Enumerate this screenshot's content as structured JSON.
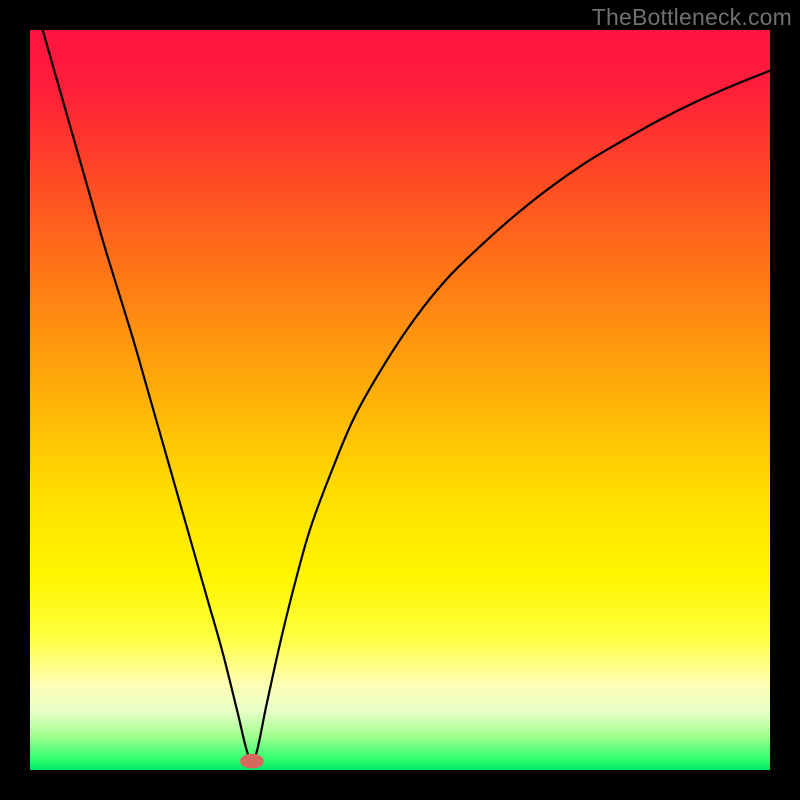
{
  "watermark": "TheBottleneck.com",
  "chart_data": {
    "type": "line",
    "title": "",
    "xlabel": "",
    "ylabel": "",
    "xlim": [
      0,
      100
    ],
    "ylim": [
      0,
      100
    ],
    "gradient_stops": [
      {
        "offset": 0.0,
        "color": "#ff1440"
      },
      {
        "offset": 0.08,
        "color": "#ff1e3a"
      },
      {
        "offset": 0.2,
        "color": "#ff4a24"
      },
      {
        "offset": 0.35,
        "color": "#ff7e14"
      },
      {
        "offset": 0.5,
        "color": "#ffb208"
      },
      {
        "offset": 0.62,
        "color": "#ffdc00"
      },
      {
        "offset": 0.74,
        "color": "#fff600"
      },
      {
        "offset": 0.82,
        "color": "#ffff40"
      },
      {
        "offset": 0.88,
        "color": "#ffffb0"
      },
      {
        "offset": 0.92,
        "color": "#e8ffc8"
      },
      {
        "offset": 0.955,
        "color": "#a0ff90"
      },
      {
        "offset": 0.985,
        "color": "#30ff70"
      },
      {
        "offset": 1.0,
        "color": "#00e864"
      }
    ],
    "series": [
      {
        "name": "bottleneck-curve",
        "x": [
          0.0,
          2,
          4,
          6,
          8,
          10,
          12,
          14,
          16,
          18,
          20,
          22,
          24,
          26,
          28,
          29.5,
          30.5,
          32,
          34,
          36,
          38,
          41,
          44,
          48,
          52,
          56,
          60,
          65,
          70,
          75,
          80,
          85,
          90,
          95,
          100
        ],
        "values": [
          106,
          99,
          92,
          85,
          78,
          71,
          64.5,
          58,
          51,
          44,
          37,
          30,
          23,
          16,
          8,
          2,
          2,
          9,
          18,
          26,
          33,
          41,
          48,
          55,
          61,
          66,
          70,
          74.5,
          78.5,
          82,
          85,
          87.8,
          90.3,
          92.5,
          94.5
        ]
      }
    ],
    "marker": {
      "name": "bottleneck-marker",
      "x": 30,
      "y": 1.2,
      "rx": 1.6,
      "ry": 1.0,
      "color": "#d46a5e"
    }
  }
}
